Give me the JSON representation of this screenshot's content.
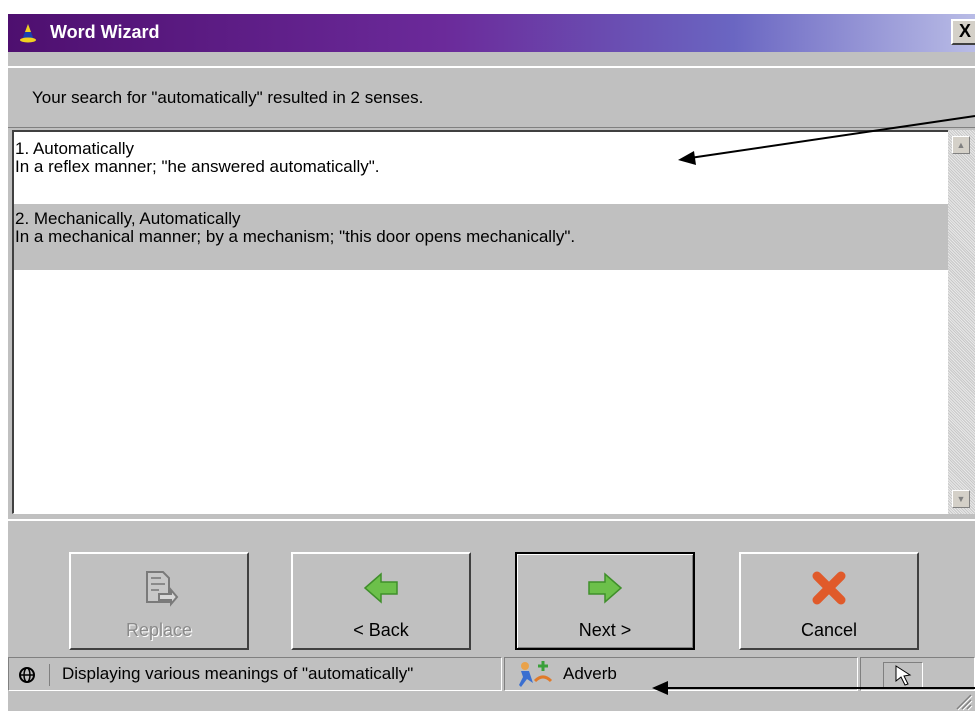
{
  "window": {
    "title": "Word Wizard",
    "close_label": "X",
    "accent_colors": [
      "#4e0f6f",
      "#6a66c2"
    ]
  },
  "search_status": "Your search for \"automatically\" resulted in 2 senses.",
  "senses": [
    {
      "heading": "1. Automatically",
      "definition": "In a reflex manner; \"he answered automatically\".",
      "selected": false
    },
    {
      "heading": "2. Mechanically, Automatically",
      "definition": "In a mechanical manner; by a mechanism; \"this door opens mechanically\".",
      "selected": true
    }
  ],
  "scrollbar": {
    "up_icon": "scroll-up-arrow-icon",
    "down_icon": "scroll-down-arrow-icon"
  },
  "buttons": {
    "replace": {
      "label": "Replace",
      "icon": "replace-document-icon",
      "enabled": false
    },
    "back": {
      "label": "< Back",
      "icon": "green-left-arrow-icon",
      "enabled": true
    },
    "next": {
      "label": "Next >",
      "icon": "green-right-arrow-icon",
      "enabled": true,
      "default": true
    },
    "cancel": {
      "label": "Cancel",
      "icon": "red-x-icon",
      "enabled": true
    }
  },
  "statusbar": {
    "message": "Displaying various meanings of \"automatically\"",
    "message_icon": "globe-icon",
    "part_of_speech": "Adverb",
    "part_of_speech_icon": "adverb-figure-icon",
    "right_icon": "resize-grip-icon"
  }
}
